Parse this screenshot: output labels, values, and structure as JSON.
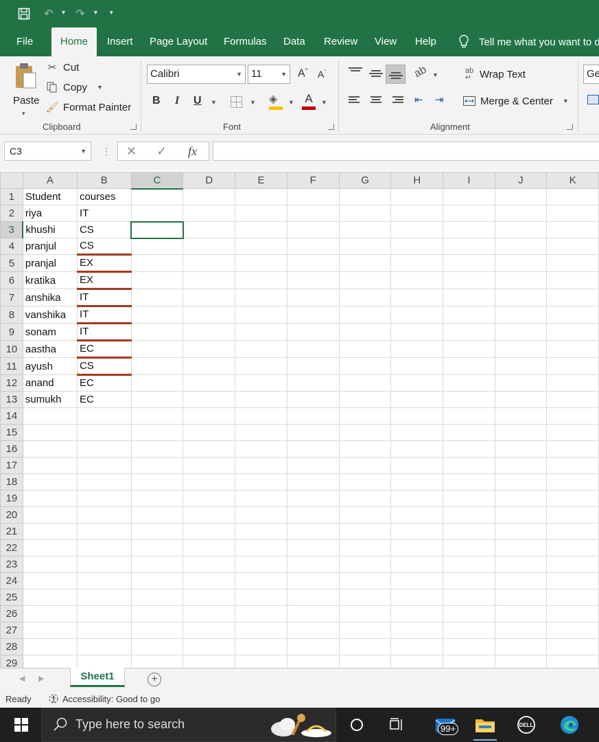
{
  "app": {
    "ribbon_tabs": [
      "File",
      "Home",
      "Insert",
      "Page Layout",
      "Formulas",
      "Data",
      "Review",
      "View",
      "Help"
    ],
    "tell_me": "Tell me what you want to do"
  },
  "ribbon": {
    "clipboard": {
      "paste": "Paste",
      "cut": "Cut",
      "copy": "Copy",
      "format_painter": "Format Painter",
      "label": "Clipboard"
    },
    "font": {
      "font_name": "Calibri",
      "font_size": "11",
      "bold": "B",
      "italic": "I",
      "underline": "U",
      "font_color_letter": "A",
      "label": "Font",
      "fill_color": "#FFC000",
      "font_color": "#C00000"
    },
    "alignment": {
      "wrap_text": "Wrap Text",
      "merge_center": "Merge & Center",
      "label": "Alignment"
    },
    "number": {
      "format": "Ge"
    }
  },
  "formula_bar": {
    "name_box": "C3",
    "fx": "fx",
    "value": ""
  },
  "grid": {
    "columns": [
      "A",
      "B",
      "C",
      "D",
      "E",
      "F",
      "G",
      "H",
      "I",
      "J",
      "K"
    ],
    "active_cell": "C3",
    "rows": [
      [
        "Student",
        "courses"
      ],
      [
        "riya",
        "IT"
      ],
      [
        "khushi",
        "CS"
      ],
      [
        "pranjul",
        "CS"
      ],
      [
        "pranjal",
        "EX"
      ],
      [
        "kratika",
        "EX"
      ],
      [
        "anshika",
        "IT"
      ],
      [
        "vanshika",
        "IT"
      ],
      [
        "sonam",
        "IT"
      ],
      [
        "aastha",
        "EC"
      ],
      [
        "ayush",
        "CS"
      ],
      [
        "anand",
        "EC"
      ],
      [
        "sumukh",
        "EC"
      ],
      [
        "",
        ""
      ],
      [
        "",
        ""
      ],
      [
        "",
        ""
      ],
      [
        "",
        ""
      ],
      [
        "",
        ""
      ],
      [
        "",
        ""
      ],
      [
        "",
        ""
      ],
      [
        "",
        ""
      ],
      [
        "",
        ""
      ],
      [
        "",
        ""
      ],
      [
        "",
        ""
      ],
      [
        "",
        ""
      ],
      [
        "",
        ""
      ],
      [
        "",
        ""
      ],
      [
        "",
        ""
      ],
      [
        "",
        ""
      ]
    ],
    "underline_color": "#A33A1F"
  },
  "sheets": {
    "tabs": [
      "Sheet1"
    ],
    "active": "Sheet1"
  },
  "status": {
    "ready": "Ready",
    "accessibility": "Accessibility: Good to go"
  },
  "taskbar": {
    "search_placeholder": "Type here to search",
    "mail_badge": "99+"
  },
  "colors": {
    "excel_green": "#217346",
    "ribbon_bg": "#F3F3F3",
    "taskbar_bg": "#1F1F1F"
  }
}
